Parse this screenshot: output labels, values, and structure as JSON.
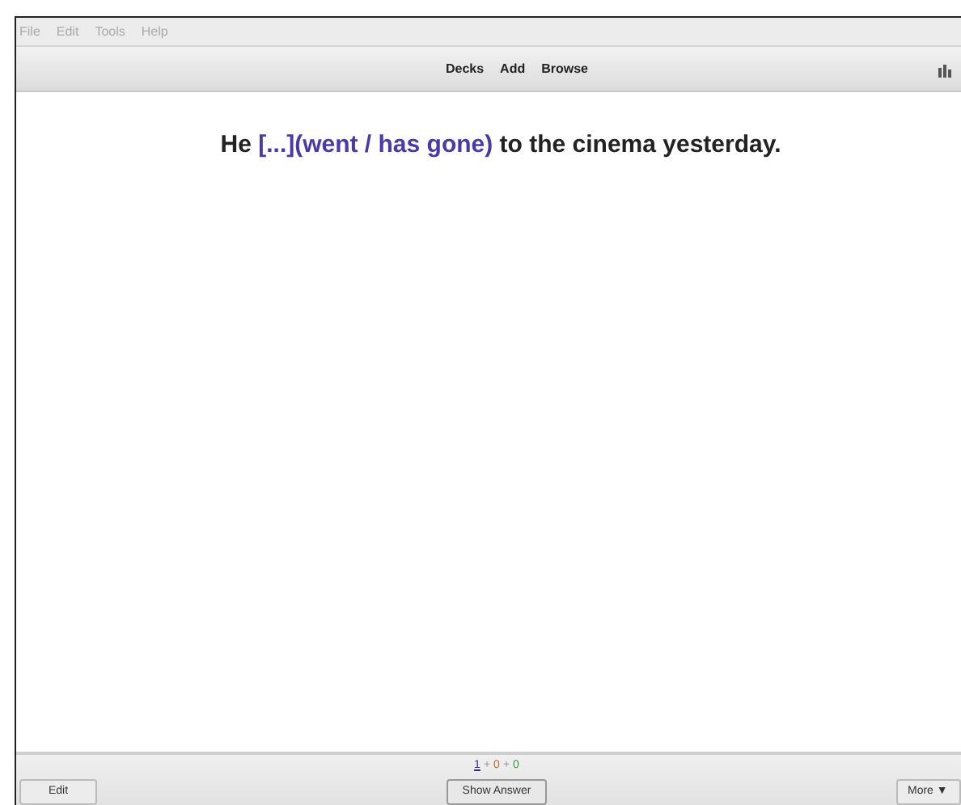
{
  "menu": [
    "File",
    "Edit",
    "Tools",
    "Help"
  ],
  "toolbar": [
    "Decks",
    "Add",
    "Browse"
  ],
  "card": [
    {
      "kind": "plain",
      "text": "He "
    },
    {
      "kind": "cloze",
      "text": "[...](went / has gone)"
    },
    {
      "kind": "plain",
      "text": " to the cinema yesterday."
    }
  ],
  "due_counts": [
    {
      "kind": "count",
      "text": "1",
      "color": "#2a2aa8",
      "underlined": true
    },
    {
      "kind": "sep",
      "text": "+"
    },
    {
      "kind": "count",
      "text": "0",
      "color": "#c8642a",
      "underlined": false
    },
    {
      "kind": "sep",
      "text": "+"
    },
    {
      "kind": "count",
      "text": "0",
      "color": "#3a9a3a",
      "underlined": false
    }
  ],
  "buttons": {
    "edit": "Edit",
    "show_answer": "Show Answer",
    "more": "More ▼"
  }
}
